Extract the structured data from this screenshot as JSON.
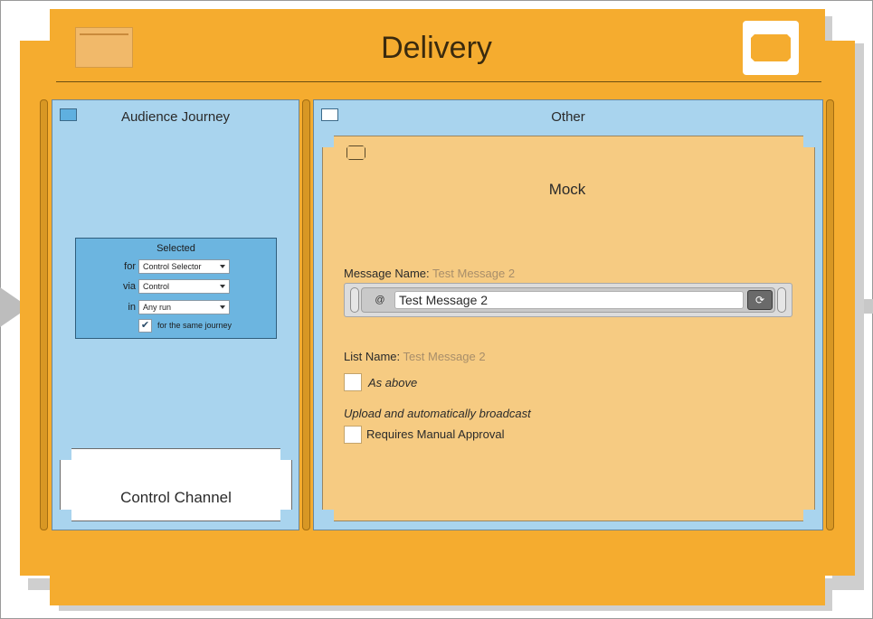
{
  "window": {
    "title": "Delivery",
    "accent_color": "#f5ac2f",
    "folder_icon": "folder-icon",
    "window_icon": "window-icon"
  },
  "left_panel": {
    "title": "Audience Journey",
    "icon": "panel-icon",
    "selected": {
      "title": "Selected",
      "rows": [
        {
          "label": "for",
          "value": "Control Selector"
        },
        {
          "label": "via",
          "value": "Control"
        },
        {
          "label": "in",
          "value": "Any run"
        }
      ],
      "same_journey_checked": true,
      "same_journey_label": "for the same journey"
    },
    "channel": {
      "label": "Control Channel"
    }
  },
  "right_panel": {
    "title": "Other",
    "icon": "panel-icon",
    "mock": {
      "title": "Mock",
      "message_name_label": "Message Name:",
      "message_name_value": "Test Message 2",
      "message_input_value": "Test Message 2",
      "at_symbol": "@",
      "refresh_icon": "refresh-icon",
      "list_name_label": "List Name:",
      "list_name_value": "Test Message 2",
      "as_above_label": "As above",
      "as_above_checked": false,
      "upload_text": "Upload and automatically broadcast",
      "manual_approval_label": "Requires Manual Approval",
      "manual_approval_checked": false
    }
  }
}
